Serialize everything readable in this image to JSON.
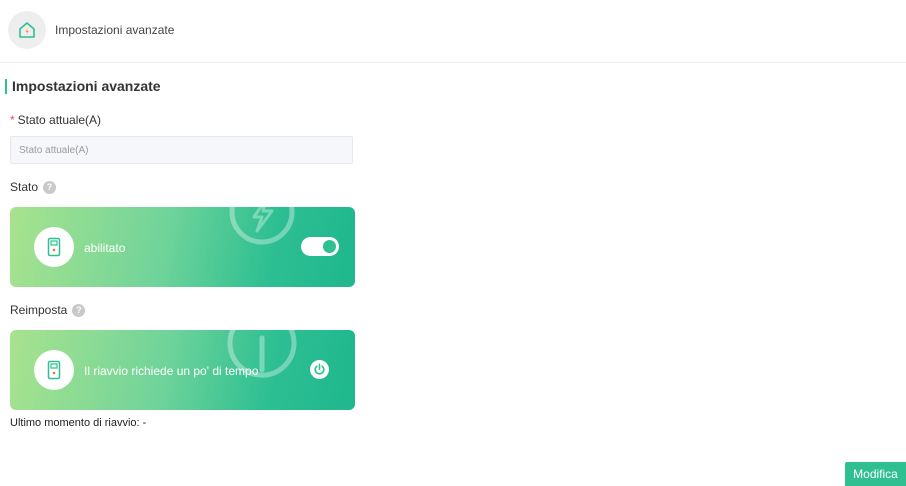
{
  "header": {
    "title": "Impostazioni avanzate",
    "icon": "home-bolt-icon"
  },
  "section": {
    "title": "Impostazioni avanzate"
  },
  "current_field": {
    "required_mark": "*",
    "label": "Stato attuale(A)",
    "placeholder": "Stato attuale(A)",
    "value": ""
  },
  "status": {
    "label": "Stato",
    "help_glyph": "?",
    "card_text": "abilitato",
    "enabled": true,
    "icon": "charger-icon"
  },
  "reset": {
    "label": "Reimposta",
    "help_glyph": "?",
    "card_text": "Il riavvio richiede un po' di tempo",
    "icon": "charger-icon"
  },
  "last_restart": {
    "label": "Ultimo momento di riavvio:",
    "value": "-"
  },
  "actions": {
    "modify_label": "Modifica"
  },
  "colors": {
    "accent": "#2fbf91",
    "required": "#f04a4a",
    "card_from": "#a8e38e",
    "card_to": "#1fb78d"
  }
}
